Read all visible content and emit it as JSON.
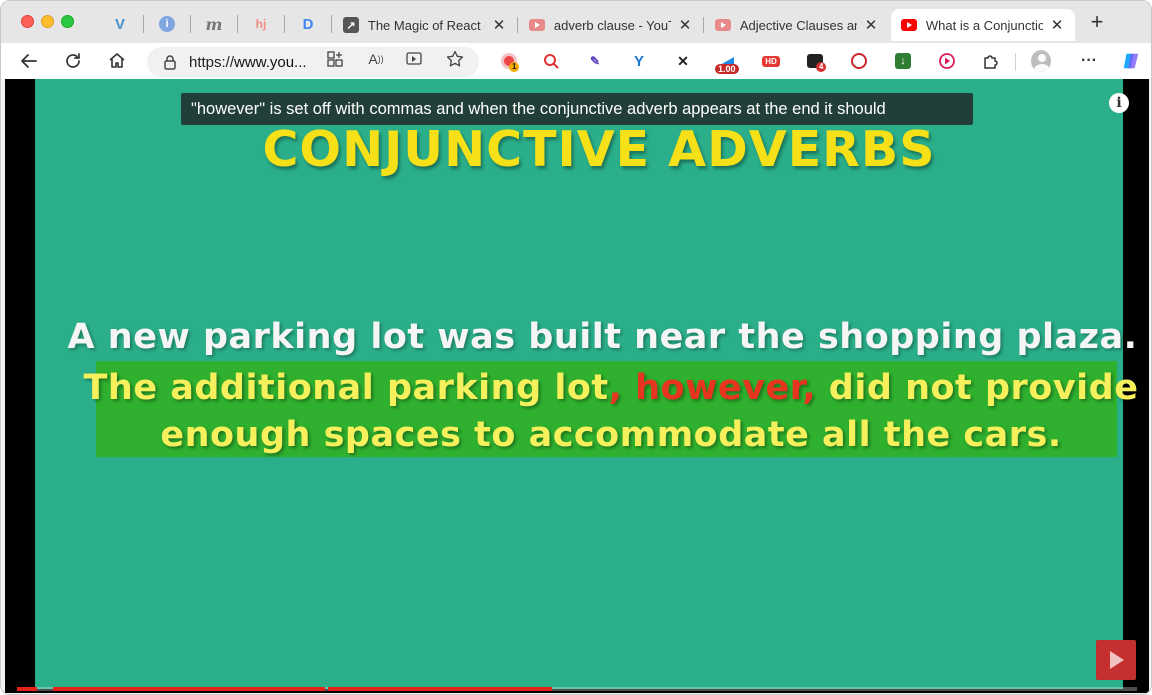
{
  "browser": {
    "pinned_tabs": [
      {
        "icon": "vimeo-icon",
        "color": "#4a90c9",
        "glyph": "V"
      },
      {
        "icon": "info-icon",
        "color": "#5b8dd8",
        "glyph": "i"
      },
      {
        "icon": "medium-icon",
        "color": "#777777",
        "glyph": "m"
      },
      {
        "icon": "hotjar-icon",
        "color": "#f28b82",
        "glyph": "hj"
      },
      {
        "icon": "d-icon",
        "color": "#4285f4",
        "glyph": "D"
      }
    ],
    "tabs": [
      {
        "title": "The Magic of React -",
        "icon": "link-arrow-icon",
        "active": false
      },
      {
        "title": "adverb clause - YouTube",
        "icon": "youtube-icon",
        "active": false
      },
      {
        "title": "Adjective Clauses and",
        "icon": "youtube-icon",
        "active": false
      },
      {
        "title": "What is a Conjunction",
        "icon": "youtube-icon",
        "active": true
      }
    ],
    "new_tab_label": "+",
    "address": {
      "url_prefix": "https://",
      "url_main": "www.you..."
    },
    "extensions": {
      "badge_1": "1",
      "speed_badge": "1.00",
      "hd_label": "HD",
      "badge_4": "4",
      "more_label": "···"
    }
  },
  "video": {
    "caption": "\"however\" is set off with commas and when the  conjunctive adverb appears at the end it should",
    "heading": "CONJUNCTIVE ADVERBS",
    "sentence_1": "A new parking lot was built near the shopping plaza.",
    "sentence_2_part_a": "The additional parking lot",
    "sentence_2_however": ", however,",
    "sentence_2_part_b": " did not provide",
    "sentence_2_line_2": "enough spaces to accommodate all the cars.",
    "info_glyph": "i",
    "progress": [
      0.32,
      0.5
    ],
    "colors": {
      "background": "#2aaf8a",
      "heading": "#f6e018",
      "highlight": "#2fb02e",
      "highlight_text": "#f6f05c",
      "however": "#e8351f"
    }
  }
}
